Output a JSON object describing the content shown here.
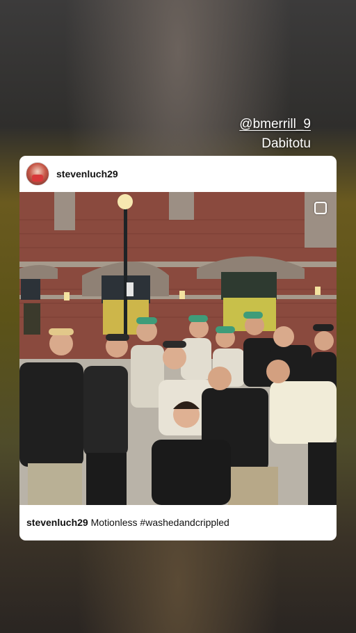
{
  "story": {
    "mention": "@bmerrill_9",
    "text": "Dabitotu"
  },
  "post": {
    "username": "stevenluch29",
    "caption_user": "stevenluch29",
    "caption_text": "Motionless #washedandcrippled"
  },
  "icons": [
    "avatar",
    "multi-photo-icon"
  ]
}
